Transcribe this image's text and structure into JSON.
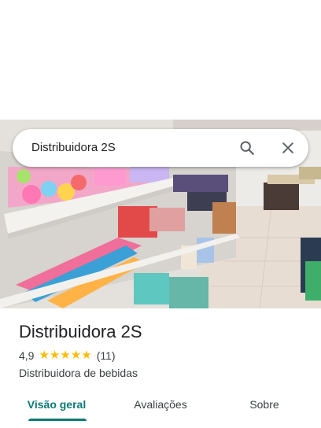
{
  "search": {
    "query": "Distribuidora 2S",
    "search_icon": "search-icon",
    "close_icon": "close-icon"
  },
  "place": {
    "name": "Distribuidora 2S",
    "rating_value": "4,9",
    "rating_stars": 5,
    "rating_count": "(11)",
    "category": "Distribuidora de bebidas"
  },
  "tabs": [
    {
      "label": "Visão geral",
      "active": true
    },
    {
      "label": "Avaliações",
      "active": false
    },
    {
      "label": "Sobre",
      "active": false
    }
  ],
  "colors": {
    "accent": "#0b7a75",
    "star": "#fbbc04",
    "text_primary": "#202124",
    "text_secondary": "#3c4043"
  }
}
